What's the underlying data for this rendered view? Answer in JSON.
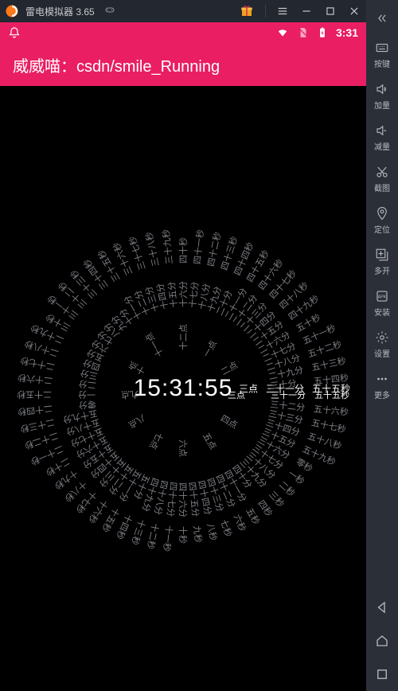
{
  "emulator": {
    "name": "雷电模拟器 3.65",
    "icon": "app-icon",
    "gift_icon": "gift-icon",
    "menu_icon": "menu-icon",
    "collapse_icon": "collapse-icon"
  },
  "side_tools": {
    "keys": {
      "label": "按键"
    },
    "vol_up": {
      "label": "加量"
    },
    "vol_dn": {
      "label": "减量"
    },
    "shot": {
      "label": "截图"
    },
    "locate": {
      "label": "定位"
    },
    "multi": {
      "label": "多开"
    },
    "install": {
      "label": "安装"
    },
    "setting": {
      "label": "设置"
    },
    "more": {
      "label": "更多"
    }
  },
  "android_nav": {
    "back": "back-icon",
    "home": "home-icon",
    "recent": "recent-icon"
  },
  "status_bar": {
    "time": "3:31",
    "wifi": "wifi-icon",
    "sim": "sim-off-icon",
    "batt": "battery-charge-icon",
    "bell": "notification-icon"
  },
  "header": {
    "title": "威威喵：csdn/smile_Running"
  },
  "clock": {
    "digital": "15:31:55",
    "current": {
      "hour": "三点",
      "minute": "三十一分",
      "second": "五十五秒"
    },
    "rings": {
      "hour": {
        "radius": 56,
        "items": [
          "一点",
          "二点",
          "三点",
          "四点",
          "五点",
          "六点",
          "七点",
          "八点",
          "九点",
          "十点",
          "十一点",
          "十二点"
        ]
      },
      "minute": {
        "radius": 110,
        "items": [
          "零分",
          "一分",
          "二分",
          "三分",
          "四分",
          "五分",
          "六分",
          "七分",
          "八分",
          "九分",
          "十分",
          "十一分",
          "十二分",
          "十三分",
          "十四分",
          "十五分",
          "十六分",
          "十七分",
          "十八分",
          "十九分",
          "二十分",
          "二十一分",
          "二十二分",
          "二十三分",
          "二十四分",
          "二十五分",
          "二十六分",
          "二十七分",
          "二十八分",
          "二十九分",
          "三十分",
          "三十一分",
          "三十二分",
          "三十三分",
          "三十四分",
          "三十五分",
          "三十六分",
          "三十七分",
          "三十八分",
          "三十九分",
          "四十分",
          "四十一分",
          "四十二分",
          "四十三分",
          "四十四分",
          "四十五分",
          "四十六分",
          "四十七分",
          "四十八分",
          "四十九分",
          "五十分",
          "五十一分",
          "五十二分",
          "五十三分",
          "五十四分",
          "五十五分",
          "五十六分",
          "五十七分",
          "五十八分",
          "五十九分"
        ]
      },
      "second": {
        "radius": 165,
        "items": [
          "零秒",
          "一秒",
          "二秒",
          "三秒",
          "四秒",
          "五秒",
          "六秒",
          "七秒",
          "八秒",
          "九秒",
          "十秒",
          "十一秒",
          "十二秒",
          "十三秒",
          "十四秒",
          "十五秒",
          "十六秒",
          "十七秒",
          "十八秒",
          "十九秒",
          "二十秒",
          "二十一秒",
          "二十二秒",
          "二十三秒",
          "二十四秒",
          "二十五秒",
          "二十六秒",
          "二十七秒",
          "二十八秒",
          "二十九秒",
          "三十秒",
          "三十一秒",
          "三十二秒",
          "三十三秒",
          "三十四秒",
          "三十五秒",
          "三十六秒",
          "三十七秒",
          "三十八秒",
          "三十九秒",
          "四十秒",
          "四十一秒",
          "四十二秒",
          "四十三秒",
          "四十四秒",
          "四十五秒",
          "四十六秒",
          "四十七秒",
          "四十八秒",
          "四十九秒",
          "五十秒",
          "五十一秒",
          "五十二秒",
          "五十三秒",
          "五十四秒",
          "五十五秒",
          "五十六秒",
          "五十七秒",
          "五十八秒",
          "五十九秒"
        ]
      }
    },
    "current_index": {
      "hour": 2,
      "minute": 31,
      "second": 55
    }
  }
}
